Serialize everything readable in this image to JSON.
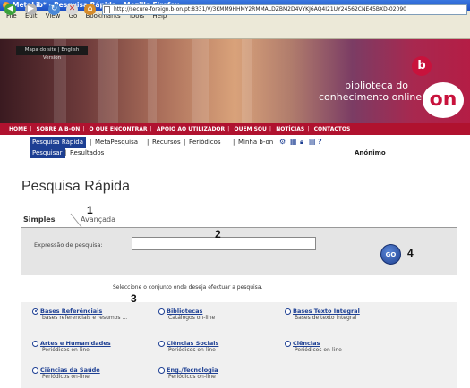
{
  "window": {
    "title": "MetaLib* - Pesquisa Rápida - Mozilla Firefox"
  },
  "menu": [
    "File",
    "Edit",
    "View",
    "Go",
    "Bookmarks",
    "Tools",
    "Help"
  ],
  "toolbar": {
    "url": "http://secure-foreign.b-on.pt:8331/V/3KMM9HHMY2RMMALDZBM2D4VYKJ6AQ4I21UY24562CNE45BXD-02090",
    "back_icon": "back-arrow-icon",
    "forward_icon": "forward-arrow-icon",
    "reload_icon": "reload-icon",
    "stop_icon": "stop-icon",
    "home_icon": "home-icon"
  },
  "banner": {
    "lang_link": "Mapa do site | English Version",
    "logo_line1": "biblioteca do",
    "logo_line2": "conhecimento online",
    "logo_b": "b",
    "logo_on": "on"
  },
  "main_nav": [
    "HOME",
    "SOBRE A B-ON",
    "O QUE ENCONTRAR",
    "APOIO AO UTILIZADOR",
    "QUEM SOU",
    "NOTÍCIAS",
    "CONTACTOS"
  ],
  "sub_nav": [
    "Pesquisa Rápida",
    "MetaPesquisa",
    "Recursos",
    "Periódicos",
    "Minha b-on"
  ],
  "sub_nav2": [
    "Pesquisar",
    "Resultados"
  ],
  "user": "Anónimo",
  "page_title": "Pesquisa Rápida",
  "tabs": [
    "Simples",
    "Avançada"
  ],
  "search": {
    "label": "Expressão de pesquisa:",
    "value": "",
    "go_label": "GO"
  },
  "markers": [
    "1",
    "2",
    "3",
    "4"
  ],
  "select_prompt": "Seleccione o conjunto onde deseja efectuar a pesquisa.",
  "options": [
    {
      "title": "Bases Referênciais",
      "desc": "bases referenciais e resumos ...",
      "selected": true
    },
    {
      "title": "Bibliotecas",
      "desc": "Catálogos on-line",
      "selected": false
    },
    {
      "title": "Bases Texto Integral",
      "desc": "Bases de texto integral",
      "selected": false
    },
    {
      "title": "Artes e Humanidades",
      "desc": "Periódicos on-line",
      "selected": false
    },
    {
      "title": "Ciências Sociais",
      "desc": "Periódicos on-line",
      "selected": false
    },
    {
      "title": "Ciências",
      "desc": "Periódicos on-line",
      "selected": false
    },
    {
      "title": "Ciências da Saúde",
      "desc": "Periódicos on-line",
      "selected": false
    },
    {
      "title": "Eng./Tecnologia",
      "desc": "Periódicos on-line",
      "selected": false
    }
  ],
  "colors": {
    "accent_red": "#b0122f",
    "nav_blue": "#1d3f93"
  }
}
